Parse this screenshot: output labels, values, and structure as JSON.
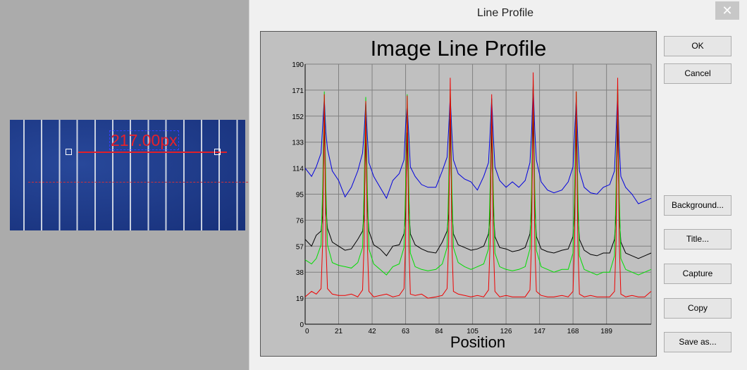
{
  "image": {
    "measurement_label": "217.00px"
  },
  "dialog": {
    "title": "Line Profile",
    "close_symbol": "✕",
    "buttons": [
      "OK",
      "Cancel",
      "Background...",
      "Title...",
      "Capture",
      "Copy",
      "Save as..."
    ]
  },
  "chart_data": {
    "type": "line",
    "title": "Image Line Profile",
    "xlabel": "Position",
    "ylabel": "",
    "xlim": [
      0,
      217
    ],
    "ylim": [
      0,
      190
    ],
    "grid": true,
    "xticks": [
      0,
      21,
      42,
      63,
      84,
      105,
      126,
      147,
      168,
      189
    ],
    "yticks": [
      0,
      19,
      38,
      57,
      76,
      95,
      114,
      133,
      152,
      171,
      190
    ],
    "x": [
      0,
      4,
      7,
      10,
      11,
      12,
      13,
      14,
      17,
      21,
      25,
      29,
      33,
      36,
      37,
      38,
      39,
      40,
      43,
      47,
      51,
      55,
      59,
      62,
      63,
      64,
      65,
      66,
      69,
      73,
      77,
      82,
      86,
      89,
      90,
      91,
      92,
      93,
      96,
      100,
      104,
      108,
      112,
      115,
      116,
      117,
      118,
      119,
      122,
      126,
      130,
      134,
      138,
      141,
      142,
      143,
      144,
      145,
      148,
      152,
      156,
      161,
      165,
      168,
      169,
      170,
      171,
      172,
      175,
      179,
      183,
      187,
      191,
      194,
      195,
      196,
      197,
      198,
      201,
      205,
      209,
      213,
      217
    ],
    "series": [
      {
        "color": "#0000dd",
        "values": [
          114,
          108,
          115,
          125,
          145,
          165,
          140,
          128,
          112,
          105,
          93,
          100,
          112,
          125,
          140,
          162,
          138,
          118,
          108,
          100,
          92,
          105,
          110,
          120,
          145,
          160,
          138,
          115,
          108,
          102,
          100,
          100,
          112,
          122,
          142,
          167,
          140,
          120,
          110,
          106,
          104,
          98,
          108,
          118,
          140,
          165,
          138,
          115,
          105,
          100,
          104,
          100,
          105,
          118,
          140,
          175,
          142,
          120,
          104,
          98,
          96,
          98,
          104,
          115,
          140,
          165,
          135,
          112,
          100,
          96,
          95,
          100,
          102,
          112,
          140,
          170,
          130,
          108,
          100,
          95,
          88,
          90,
          92
        ]
      },
      {
        "color": "#000000",
        "values": [
          62,
          57,
          65,
          68,
          80,
          150,
          85,
          70,
          60,
          57,
          54,
          55,
          62,
          68,
          80,
          140,
          85,
          68,
          58,
          55,
          50,
          57,
          58,
          66,
          80,
          140,
          85,
          66,
          58,
          55,
          53,
          52,
          60,
          68,
          80,
          150,
          85,
          66,
          58,
          56,
          54,
          55,
          57,
          66,
          80,
          145,
          84,
          64,
          56,
          55,
          53,
          54,
          56,
          66,
          82,
          155,
          86,
          64,
          55,
          53,
          52,
          54,
          55,
          64,
          80,
          145,
          82,
          62,
          54,
          51,
          50,
          52,
          52,
          62,
          80,
          150,
          80,
          60,
          52,
          50,
          48,
          50,
          52
        ]
      },
      {
        "color": "#00dd00",
        "values": [
          47,
          44,
          48,
          58,
          100,
          170,
          100,
          58,
          45,
          43,
          42,
          41,
          45,
          56,
          100,
          166,
          100,
          55,
          44,
          40,
          36,
          42,
          44,
          56,
          100,
          168,
          100,
          52,
          42,
          40,
          39,
          40,
          44,
          56,
          100,
          172,
          100,
          56,
          45,
          42,
          40,
          42,
          44,
          55,
          100,
          164,
          98,
          52,
          42,
          40,
          39,
          40,
          42,
          55,
          100,
          178,
          100,
          54,
          42,
          40,
          38,
          40,
          40,
          52,
          100,
          170,
          98,
          50,
          40,
          38,
          36,
          38,
          38,
          50,
          100,
          175,
          96,
          48,
          40,
          38,
          36,
          38,
          40
        ]
      },
      {
        "color": "#ee0000",
        "values": [
          20,
          24,
          22,
          26,
          60,
          168,
          60,
          26,
          22,
          21,
          21,
          22,
          20,
          25,
          60,
          163,
          60,
          24,
          20,
          21,
          22,
          20,
          21,
          26,
          60,
          167,
          60,
          22,
          21,
          22,
          19,
          20,
          21,
          26,
          60,
          180,
          60,
          24,
          22,
          21,
          20,
          21,
          20,
          25,
          60,
          168,
          60,
          24,
          20,
          21,
          20,
          20,
          20,
          25,
          60,
          184,
          60,
          24,
          21,
          20,
          20,
          21,
          20,
          24,
          60,
          170,
          60,
          22,
          20,
          21,
          20,
          20,
          20,
          24,
          60,
          180,
          60,
          22,
          20,
          21,
          20,
          20,
          24
        ]
      }
    ]
  }
}
